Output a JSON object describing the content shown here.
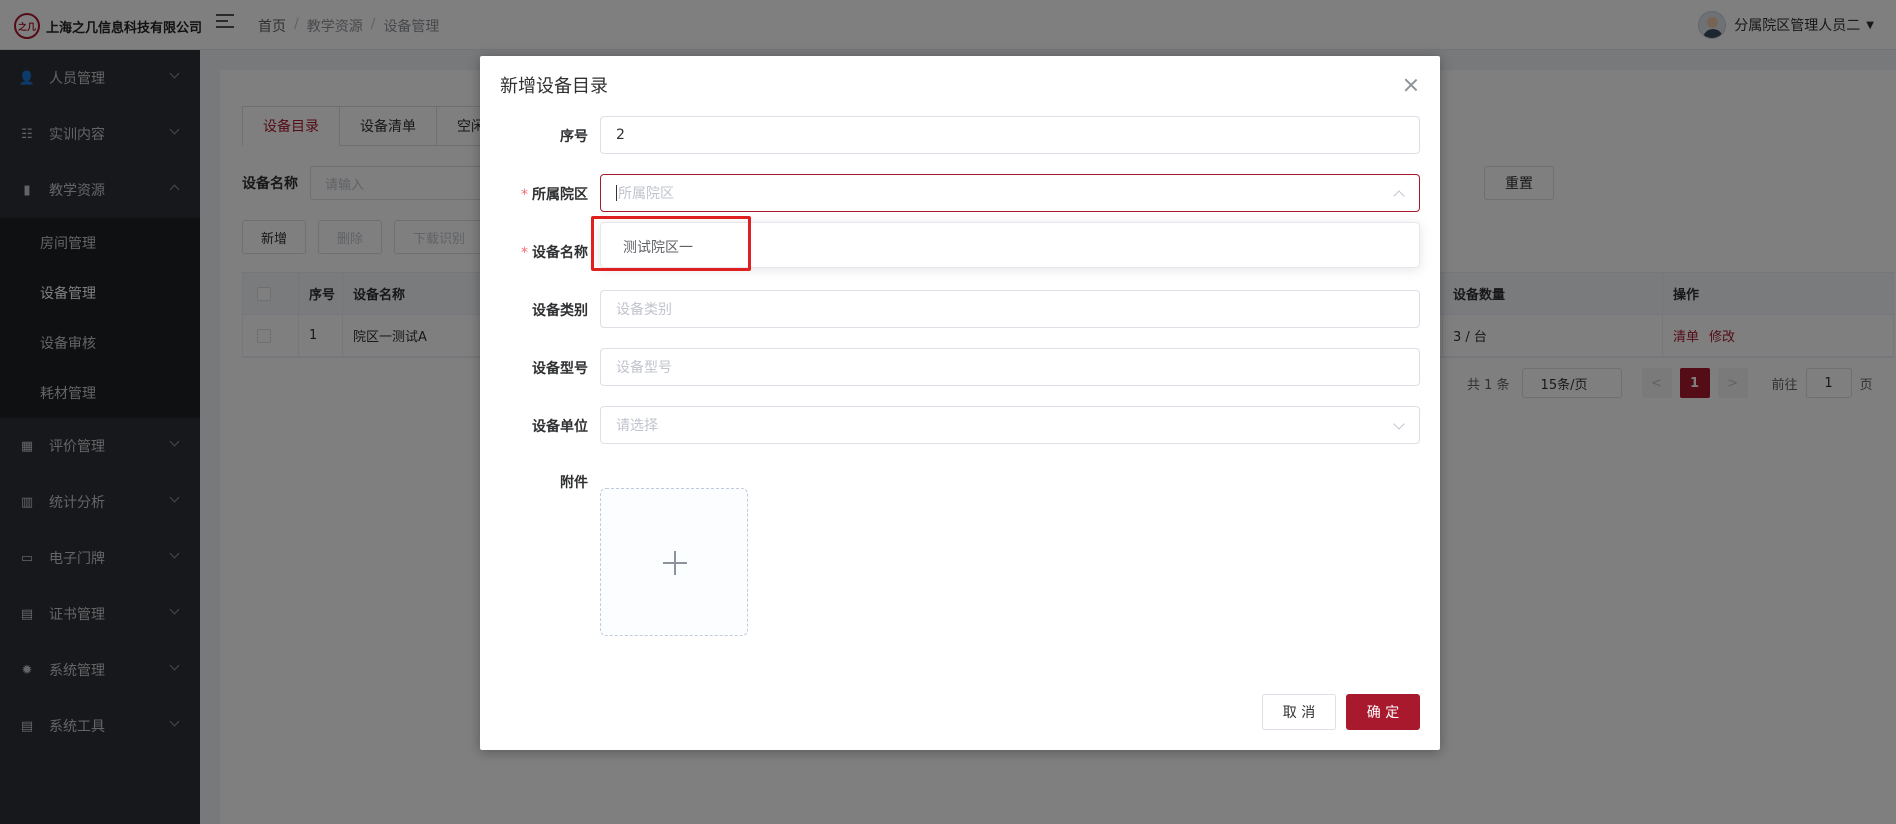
{
  "header": {
    "logo_mark": "之几",
    "company": "上海之几信息科技有限公司",
    "breadcrumb": [
      "首页",
      "教学资源",
      "设备管理"
    ],
    "breadcrumb_sep": "/",
    "user_name": "分属院区管理人员二",
    "user_caret": "▼"
  },
  "sidebar": {
    "items": [
      {
        "label": "人员管理",
        "icon": "person-icon",
        "glyph": "👤"
      },
      {
        "label": "实训内容",
        "icon": "book-icon",
        "glyph": "☷"
      },
      {
        "label": "教学资源",
        "icon": "resource-icon",
        "glyph": "▮"
      },
      {
        "label": "评价管理",
        "icon": "evaluation-icon",
        "glyph": "▦"
      },
      {
        "label": "统计分析",
        "icon": "bar-chart-icon",
        "glyph": "▥"
      },
      {
        "label": "电子门牌",
        "icon": "monitor-icon",
        "glyph": "▭"
      },
      {
        "label": "证书管理",
        "icon": "certificate-icon",
        "glyph": "▤"
      },
      {
        "label": "系统管理",
        "icon": "gear-icon",
        "glyph": "✹"
      },
      {
        "label": "系统工具",
        "icon": "toolbox-icon",
        "glyph": "▤"
      }
    ],
    "subitems": [
      {
        "label": "房间管理"
      },
      {
        "label": "设备管理"
      },
      {
        "label": "设备审核"
      },
      {
        "label": "耗材管理"
      }
    ]
  },
  "main": {
    "tabs": [
      "设备目录",
      "设备清单",
      "空闲"
    ],
    "search_label": "设备名称",
    "search_placeholder": "请输入",
    "reset_label": "重置",
    "actions": [
      "新增",
      "删除",
      "下载识别"
    ],
    "table": {
      "headers": [
        "序号",
        "设备名称",
        "设备数量",
        "操作"
      ],
      "rows": [
        {
          "index": "1",
          "name": "院区一测试A",
          "count": "3 / 台",
          "op1": "清单",
          "op2": "修改"
        }
      ]
    },
    "pager": {
      "total": "共 1 条",
      "page_size": "15条/页",
      "prev": "<",
      "current": "1",
      "next": ">",
      "goto_label": "前往",
      "goto_value": "1",
      "page_suffix": "页"
    }
  },
  "dialog": {
    "title": "新增设备目录",
    "fields": {
      "index_label": "序号",
      "index_value": "2",
      "campus_label": "所属院区",
      "campus_placeholder": "所属院区",
      "name_label": "设备名称",
      "category_label": "设备类别",
      "category_placeholder": "设备类别",
      "model_label": "设备型号",
      "model_placeholder": "设备型号",
      "unit_label": "设备单位",
      "unit_placeholder": "请选择",
      "attachment_label": "附件",
      "required_mark": "*"
    },
    "dropdown_options": [
      "测试院区一"
    ],
    "cancel_label": "取 消",
    "ok_label": "确 定"
  },
  "colors": {
    "brand": "#a8192e",
    "sidebar_bg": "#2f3136",
    "highlight": "#e02020"
  }
}
